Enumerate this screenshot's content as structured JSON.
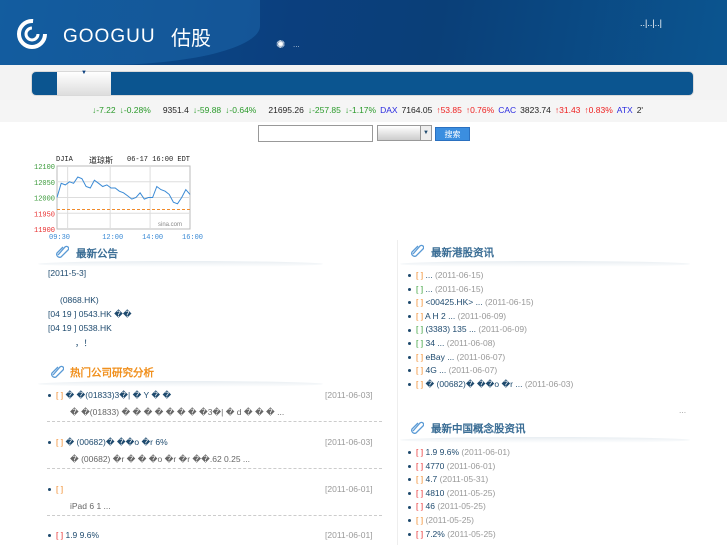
{
  "header": {
    "brand": "GOOGUU",
    "brand_cn": "估股",
    "top_links": "..|..|..|",
    "sub": "..."
  },
  "ticker": [
    {
      "t": "↓-7.22",
      "c": "g"
    },
    {
      "t": "↓-0.28%",
      "c": "g"
    },
    {
      "t": "9351.4",
      "c": "k"
    },
    {
      "t": "↓-59.88",
      "c": "g"
    },
    {
      "t": "↓-0.64%",
      "c": "g"
    },
    {
      "t": "21695.26",
      "c": "k"
    },
    {
      "t": "↓-257.85",
      "c": "g"
    },
    {
      "t": "↓-1.17%",
      "c": "g"
    },
    {
      "t": "DAX",
      "c": "b"
    },
    {
      "t": "7164.05",
      "c": "k"
    },
    {
      "t": "↑53.85",
      "c": "r"
    },
    {
      "t": "↑0.76%",
      "c": "r"
    },
    {
      "t": "CAC",
      "c": "b"
    },
    {
      "t": "3823.74",
      "c": "k"
    },
    {
      "t": "↑31.43",
      "c": "r"
    },
    {
      "t": "↑0.83%",
      "c": "r"
    },
    {
      "t": "ATX",
      "c": "b"
    },
    {
      "t": "2'",
      "c": "k"
    }
  ],
  "search": {
    "button": "搜索",
    "value": "",
    "select": ""
  },
  "chart_data": {
    "type": "line",
    "title": "DJIA",
    "title_cn": "道琼斯",
    "timestamp": "06-17 16:00 EDT",
    "source": "sina.com",
    "y_ticks": [
      "12100",
      "12050",
      "12000",
      "11950",
      "11900"
    ],
    "ylim": [
      11900,
      12100
    ],
    "x_ticks": [
      "09:30",
      "12:00",
      "14:00",
      "16:00"
    ],
    "prev_close": 11962,
    "values": [
      12000,
      12045,
      12040,
      12050,
      12045,
      12065,
      12060,
      12035,
      12030,
      12055,
      12045,
      12035,
      12040,
      12030,
      12030,
      12020,
      12015,
      12005,
      11995,
      12000,
      12015,
      11995,
      12000,
      12000,
      12035,
      12025,
      12020,
      12010,
      11985,
      11980,
      12000,
      12025,
      12010
    ]
  },
  "notices": {
    "title": "最新公告",
    "lines": [
      "[2011-5-3]",
      "(0868.HK)",
      "[04 19 ] 0543.HK    ��",
      "[04 19 ] 0538.HK",
      "，！"
    ]
  },
  "research": {
    "title": "热门公司研究分析",
    "items": [
      {
        "tag": "[ ]",
        "tc": "o",
        "title": "� �(01833)3�|  � Y  �  �",
        "date": "[2011-06-03]",
        "summary": "� �(01833)     � � �   � �    �    �  �3�|   �  d  � �  �    ..."
      },
      {
        "tag": "[ ]",
        "tc": "o",
        "title": "� (00682)� ��o  �r    6%",
        "date": "[2011-06-03]",
        "summary": "� (00682) �r          �     �    �o  �r      �r  ��.62   0.25   ..."
      },
      {
        "tag": "[ ]",
        "tc": "o",
        "title": "",
        "date": "[2011-06-01]",
        "summary": "iPad        6 1                          ..."
      },
      {
        "tag": "[ ]",
        "tc": "rd",
        "title": "      1.9     9.6%",
        "date": "[2011-06-01]",
        "summary": ""
      }
    ]
  },
  "hk": {
    "title": "最新港股资讯",
    "items": [
      {
        "tag": "[ ]",
        "tc": "o",
        "text": "     ...",
        "date": "(2011-06-15)"
      },
      {
        "tag": "[ ]",
        "tc": "gr",
        "text": "     ...",
        "date": "(2011-06-15)"
      },
      {
        "tag": "[ ]",
        "tc": "o",
        "text": "  <00425.HK>         ...",
        "date": "(2011-06-15)"
      },
      {
        "tag": "[ ]",
        "tc": "o",
        "text": "  A        H  2   ...",
        "date": "(2011-06-09)"
      },
      {
        "tag": "[ ]",
        "tc": "gr",
        "text": "(3383)      135      ...",
        "date": "(2011-06-09)"
      },
      {
        "tag": "[ ]",
        "tc": "gr",
        "text": "         34      ...",
        "date": "(2011-06-08)"
      },
      {
        "tag": "[ ]",
        "tc": "o",
        "text": "     eBay      ...",
        "date": "(2011-06-07)"
      },
      {
        "tag": "[ ]",
        "tc": "o",
        "text": "    4G     ...",
        "date": "(2011-06-07)"
      },
      {
        "tag": "[ ]",
        "tc": "o",
        "text": "� (00682)�  ��o  �r    ...",
        "date": "(2011-06-03)"
      }
    ],
    "more": "..."
  },
  "cn": {
    "title": "最新中国概念股资讯",
    "items": [
      {
        "tag": "[ ]",
        "tc": "rd",
        "text": "       1.9     9.6%",
        "date": "(2011-06-01)"
      },
      {
        "tag": "[ ]",
        "tc": "rd",
        "text": "           4770",
        "date": "(2011-06-01)"
      },
      {
        "tag": "[ ]",
        "tc": "o",
        "text": "4.7",
        "date": "(2011-05-31)"
      },
      {
        "tag": "[ ]",
        "tc": "rd",
        "text": "      4810",
        "date": "(2011-05-25)"
      },
      {
        "tag": "[ ]",
        "tc": "rd",
        "text": "      46",
        "date": "(2011-05-25)"
      },
      {
        "tag": "[ ]",
        "tc": "o",
        "text": "",
        "date": "(2011-05-25)"
      },
      {
        "tag": "[ ]",
        "tc": "rd",
        "text": "          7.2%",
        "date": "(2011-05-25)"
      }
    ]
  }
}
